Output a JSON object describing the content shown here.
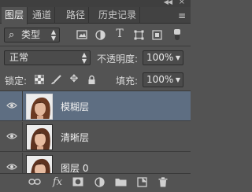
{
  "header": {
    "collapse_icon": "double-chevron-icon",
    "close_icon": "close-icon",
    "menu_icon": "panel-menu-icon"
  },
  "tabs": [
    {
      "label": "图层",
      "active": true
    },
    {
      "label": "通道",
      "active": false
    },
    {
      "label": "路径",
      "active": false
    },
    {
      "label": "历史记录",
      "active": false
    }
  ],
  "filter": {
    "search_glyph": "⌕",
    "kind_label": "类型"
  },
  "blend": {
    "mode": "正常",
    "opacity_label": "不透明度:",
    "opacity_value": "100%"
  },
  "lock": {
    "label": "锁定:",
    "fill_label": "填充:",
    "fill_value": "100%"
  },
  "layers": [
    {
      "name": "模糊层",
      "selected": true
    },
    {
      "name": "清晰层",
      "selected": false
    },
    {
      "name": "图层 0",
      "selected": false
    }
  ],
  "footer": {
    "fx_label": "fx"
  },
  "colors": {
    "panel_bg": "#535353",
    "selected_row": "#5e6e82",
    "tab_bar": "#424242"
  }
}
